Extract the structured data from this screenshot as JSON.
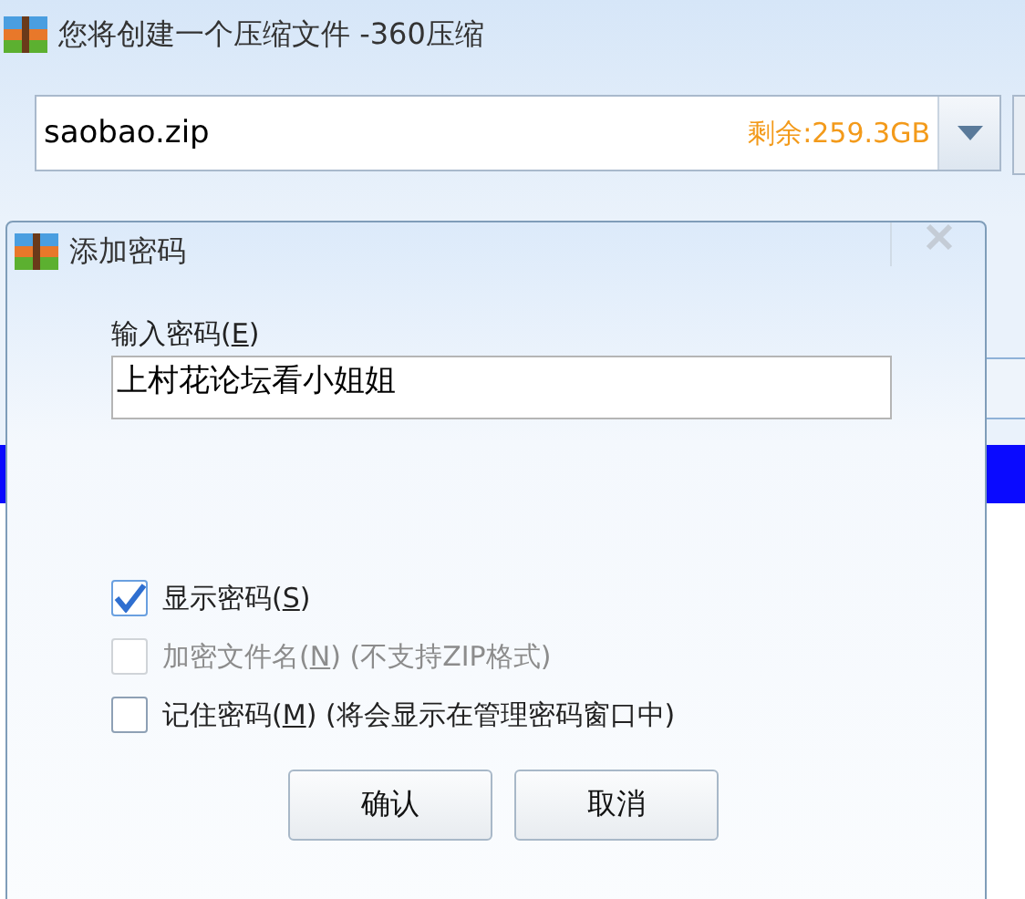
{
  "window": {
    "title": "您将创建一个压缩文件 -360压缩"
  },
  "path_field": {
    "value": "saobao.zip",
    "free_space": "剩余:259.3GB"
  },
  "dialog": {
    "title": "添加密码",
    "password_label": {
      "prefix": "输入密码(",
      "key": "E",
      "suffix": ")"
    },
    "password_field": {
      "value": "上村花论坛看小姐姐"
    },
    "options": [
      {
        "prefix": "显示密码(",
        "key": "S",
        "suffix": ")",
        "checked": true,
        "disabled": false
      },
      {
        "prefix": "加密文件名(",
        "key": "N",
        "suffix": ")",
        "note": "(不支持ZIP格式)",
        "checked": false,
        "disabled": true
      },
      {
        "prefix": "记住密码(",
        "key": "M",
        "suffix": ")",
        "note": "(将会显示在管理密码窗口中)",
        "checked": false,
        "disabled": false
      }
    ],
    "buttons": [
      "确认",
      "取消"
    ]
  }
}
